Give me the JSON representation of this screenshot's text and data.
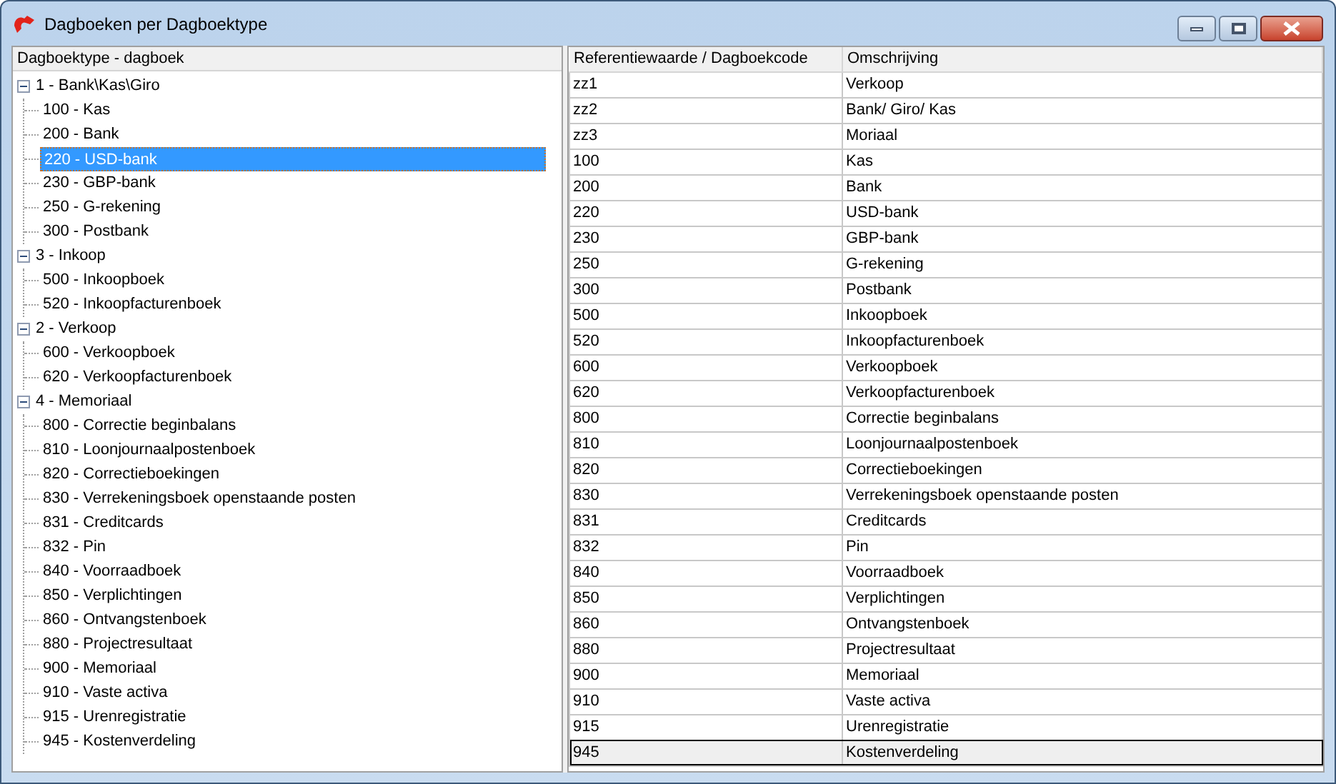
{
  "window": {
    "title": "Dagboeken per Dagboektype"
  },
  "tree": {
    "header": "Dagboektype - dagboek",
    "items": [
      {
        "label": "1 - Bank\\Kas\\Giro",
        "expanded": true,
        "children": [
          {
            "label": "100 - Kas",
            "selected": false
          },
          {
            "label": "200 - Bank",
            "selected": false
          },
          {
            "label": "220 - USD-bank",
            "selected": true
          },
          {
            "label": "230 - GBP-bank",
            "selected": false
          },
          {
            "label": "250 - G-rekening",
            "selected": false
          },
          {
            "label": "300 - Postbank",
            "selected": false
          }
        ]
      },
      {
        "label": "3 - Inkoop",
        "expanded": true,
        "children": [
          {
            "label": "500 - Inkoopboek",
            "selected": false
          },
          {
            "label": "520 - Inkoopfacturenboek",
            "selected": false
          }
        ]
      },
      {
        "label": "2 - Verkoop",
        "expanded": true,
        "children": [
          {
            "label": "600 - Verkoopboek",
            "selected": false
          },
          {
            "label": "620 - Verkoopfacturenboek",
            "selected": false
          }
        ]
      },
      {
        "label": "4 - Memoriaal",
        "expanded": true,
        "children": [
          {
            "label": "800 - Correctie beginbalans",
            "selected": false
          },
          {
            "label": "810 - Loonjournaalpostenboek",
            "selected": false
          },
          {
            "label": "820 - Correctieboekingen",
            "selected": false
          },
          {
            "label": "830 - Verrekeningsboek openstaande posten",
            "selected": false
          },
          {
            "label": "831 - Creditcards",
            "selected": false
          },
          {
            "label": "832 - Pin",
            "selected": false
          },
          {
            "label": "840 - Voorraadboek",
            "selected": false
          },
          {
            "label": "850 - Verplichtingen",
            "selected": false
          },
          {
            "label": "860 - Ontvangstenboek",
            "selected": false
          },
          {
            "label": "880 - Projectresultaat",
            "selected": false
          },
          {
            "label": "900 - Memoriaal",
            "selected": false
          },
          {
            "label": "910 - Vaste activa",
            "selected": false
          },
          {
            "label": "915 - Urenregistratie",
            "selected": false
          },
          {
            "label": "945 - Kostenverdeling",
            "selected": false
          }
        ]
      }
    ]
  },
  "table": {
    "columns": [
      "Referentiewaarde / Dagboekcode",
      "Omschrijving"
    ],
    "rows": [
      {
        "cells": [
          "zz1",
          "Verkoop"
        ],
        "selected": false
      },
      {
        "cells": [
          "zz2",
          "Bank/ Giro/ Kas"
        ],
        "selected": false
      },
      {
        "cells": [
          "zz3",
          "Moriaal"
        ],
        "selected": false
      },
      {
        "cells": [
          "100",
          "Kas"
        ],
        "selected": false
      },
      {
        "cells": [
          "200",
          "Bank"
        ],
        "selected": false
      },
      {
        "cells": [
          "220",
          "USD-bank"
        ],
        "selected": false
      },
      {
        "cells": [
          "230",
          "GBP-bank"
        ],
        "selected": false
      },
      {
        "cells": [
          "250",
          "G-rekening"
        ],
        "selected": false
      },
      {
        "cells": [
          "300",
          "Postbank"
        ],
        "selected": false
      },
      {
        "cells": [
          "500",
          "Inkoopboek"
        ],
        "selected": false
      },
      {
        "cells": [
          "520",
          "Inkoopfacturenboek"
        ],
        "selected": false
      },
      {
        "cells": [
          "600",
          "Verkoopboek"
        ],
        "selected": false
      },
      {
        "cells": [
          "620",
          "Verkoopfacturenboek"
        ],
        "selected": false
      },
      {
        "cells": [
          "800",
          "Correctie beginbalans"
        ],
        "selected": false
      },
      {
        "cells": [
          "810",
          "Loonjournaalpostenboek"
        ],
        "selected": false
      },
      {
        "cells": [
          "820",
          "Correctieboekingen"
        ],
        "selected": false
      },
      {
        "cells": [
          "830",
          "Verrekeningsboek openstaande posten"
        ],
        "selected": false
      },
      {
        "cells": [
          "831",
          "Creditcards"
        ],
        "selected": false
      },
      {
        "cells": [
          "832",
          "Pin"
        ],
        "selected": false
      },
      {
        "cells": [
          "840",
          "Voorraadboek"
        ],
        "selected": false
      },
      {
        "cells": [
          "850",
          "Verplichtingen"
        ],
        "selected": false
      },
      {
        "cells": [
          "860",
          "Ontvangstenboek"
        ],
        "selected": false
      },
      {
        "cells": [
          "880",
          "Projectresultaat"
        ],
        "selected": false
      },
      {
        "cells": [
          "900",
          "Memoriaal"
        ],
        "selected": false
      },
      {
        "cells": [
          "910",
          "Vaste activa"
        ],
        "selected": false
      },
      {
        "cells": [
          "915",
          "Urenregistratie"
        ],
        "selected": false
      },
      {
        "cells": [
          "945",
          "Kostenverdeling"
        ],
        "selected": true
      }
    ]
  }
}
